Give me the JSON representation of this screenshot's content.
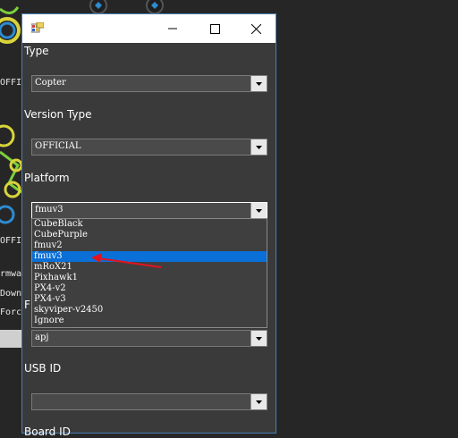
{
  "background": {
    "labels": [
      "OFFI",
      "OFFIV",
      "rmwa",
      "Downl",
      "Force"
    ]
  },
  "dialog": {
    "controls": {
      "minimize": "—",
      "maximize": "☐",
      "close": "✕"
    },
    "type": {
      "label": "Type",
      "value": "Copter"
    },
    "version_type": {
      "label": "Version Type",
      "value": "OFFICIAL"
    },
    "platform": {
      "label": "Platform",
      "value": "fmuv3",
      "options": [
        "CubeBlack",
        "CubePurple",
        "fmuv2",
        "fmuv3",
        "mRoX21",
        "Pixhawk1",
        "PX4-v2",
        "PX4-v3",
        "skyviper-v2450",
        "Ignore"
      ],
      "selected": "fmuv3"
    },
    "partial_label": "F",
    "next_combo_value": "apj",
    "usb_id": {
      "label": "USB ID",
      "value": ""
    },
    "board_id": {
      "label": "Board ID"
    }
  },
  "colors": {
    "selection": "#0a6fd6",
    "annotation_arrow": "#e0141e"
  }
}
